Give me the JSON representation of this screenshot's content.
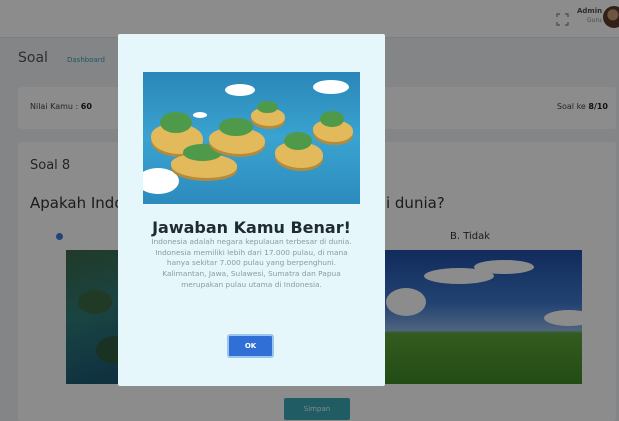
{
  "header": {
    "admin_name": "Admin",
    "admin_role": "Guru"
  },
  "page": {
    "title": "Soal",
    "breadcrumb": "Dashboard"
  },
  "score_card": {
    "score_label": "Nilai Kamu : ",
    "score_value": "60",
    "progress_label": "Soal ke ",
    "progress_value": "8/10"
  },
  "question": {
    "heading": "Soal 8",
    "text": "Apakah Indonesia negara kepulauan terbesar di dunia?",
    "option_b_label": "B. Tidak",
    "save_label": "Simpan"
  },
  "modal": {
    "title": "Jawaban Kamu Benar!",
    "body": "Indonesia adalah negara kepulauan terbesar di dunia. Indonesia memiliki lebih dari 17.000 pulau, di mana hanya sekitar 7.000 pulau yang berpenghuni. Kalimantan, Jawa, Sulawesi, Sumatra dan Papua merupakan pulau utama di Indonesia.",
    "ok_label": "OK"
  },
  "colors": {
    "accent": "#3aa8b5",
    "ok_button": "#2f6fd6",
    "modal_background": "#e5f7fa"
  }
}
